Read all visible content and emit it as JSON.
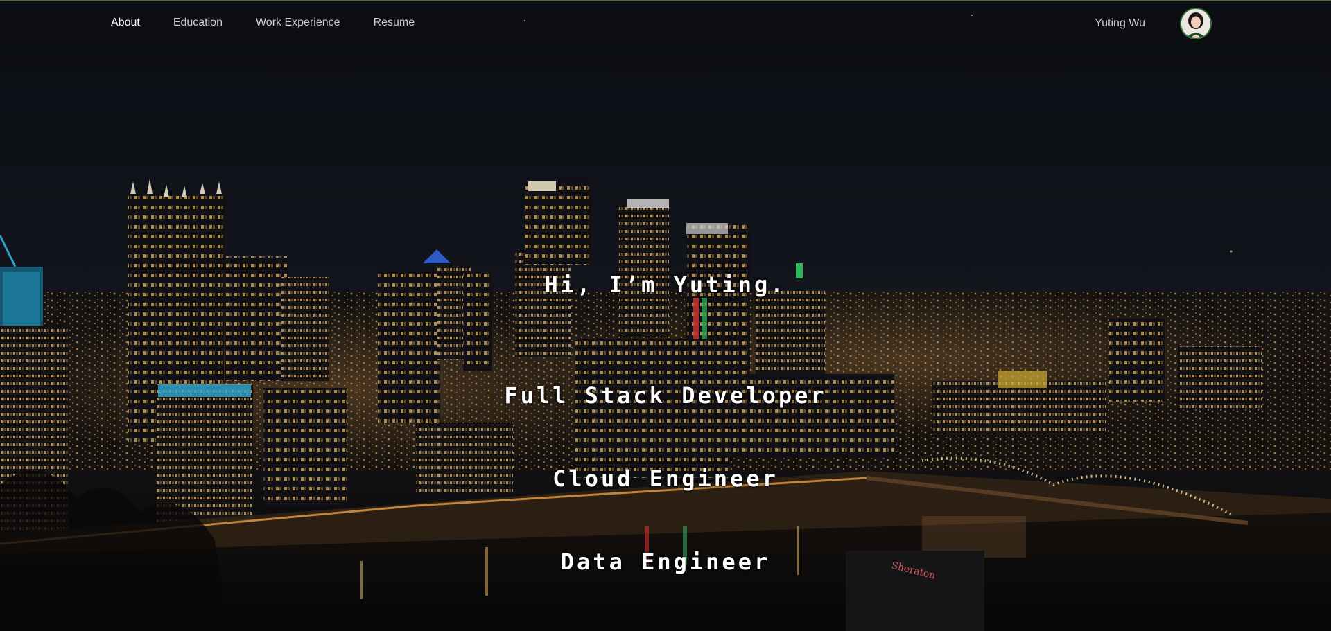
{
  "nav": {
    "items": [
      {
        "label": "About",
        "active": true
      },
      {
        "label": "Education",
        "active": false
      },
      {
        "label": "Work Experience",
        "active": false
      },
      {
        "label": "Resume",
        "active": false
      }
    ],
    "user_name": "Yuting Wu",
    "avatar_icon": "profile-photo-icon"
  },
  "hero": {
    "greeting": "Hi, I’m Yuting.",
    "roles": [
      "Full Stack Developer",
      "Cloud Engineer",
      "Data Engineer"
    ],
    "background": "pittsburgh-night-skyline"
  },
  "colors": {
    "sky": "#10131a",
    "text": "#ffffff",
    "nav_text": "#c9ccd2",
    "avatar_border": "#2e6b3a"
  }
}
